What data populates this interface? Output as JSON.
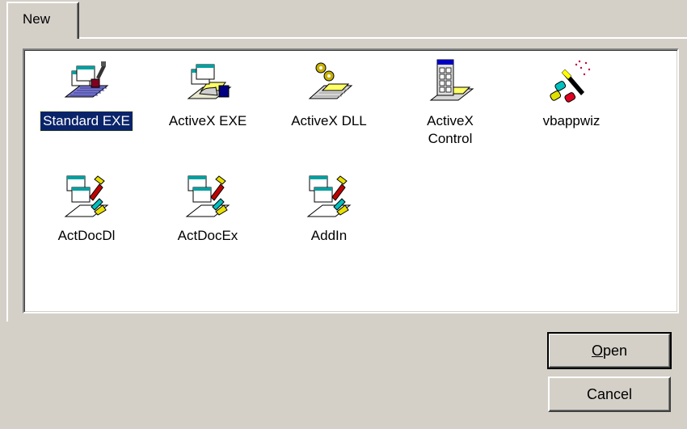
{
  "tabs": [
    {
      "label": "New",
      "selected": true
    }
  ],
  "items": [
    {
      "label": "Standard EXE",
      "icon": "standard-exe-icon",
      "selected": true
    },
    {
      "label": "ActiveX EXE",
      "icon": "activex-exe-icon",
      "selected": false
    },
    {
      "label": "ActiveX DLL",
      "icon": "activex-dll-icon",
      "selected": false
    },
    {
      "label": "ActiveX\nControl",
      "icon": "activex-control-icon",
      "selected": false
    },
    {
      "label": "vbappwiz",
      "icon": "wizard-icon",
      "selected": false
    },
    {
      "label": "ActDocDl",
      "icon": "activex-document-dll-icon",
      "selected": false
    },
    {
      "label": "ActDocEx",
      "icon": "activex-document-exe-icon",
      "selected": false
    },
    {
      "label": "AddIn",
      "icon": "addin-icon",
      "selected": false
    }
  ],
  "buttons": {
    "open": {
      "label_prefix": "O",
      "label_rest": "pen",
      "accelerator": "O",
      "default": true
    },
    "cancel": {
      "label": "Cancel"
    }
  },
  "colors": {
    "selection": "#0a246a",
    "dialog_bg": "#d4d0c8"
  }
}
